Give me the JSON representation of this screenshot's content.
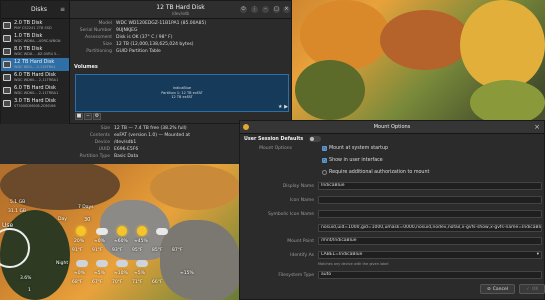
{
  "disks_window": {
    "sidebar_title": "Disks",
    "disks": [
      {
        "name": "2.0 TB Disk",
        "model": "PNY CS2241 2TB SSD"
      },
      {
        "name": "1.0 TB Disk",
        "model": "WDC WD6A...-00RC-WBGN"
      },
      {
        "name": "8.0 TB Disk",
        "model": "WDC WD8... -6Z-0VR4 5..."
      },
      {
        "name": "12 TB Hard Disk",
        "model": "WDC WD1... 2-11EFRA1"
      },
      {
        "name": "6.0 TB Hard Disk",
        "model": "WDC WD60... 2-11TRBA1"
      },
      {
        "name": "6.0 TB Hard Disk",
        "model": "WDC WD60... 2-11TRBA1"
      },
      {
        "name": "3.0 TB Hard Disk",
        "model": "ST3000DM008-2DM166"
      }
    ],
    "selected_index": 3,
    "header_title": "12 TB Hard Disk",
    "header_subtitle": "/dev/sdb",
    "drive_info": [
      {
        "key": "Model",
        "value": "WDC WD120EDGZ-11B1PA1 (85.00A85)"
      },
      {
        "key": "Serial Number",
        "value": "9UJNKJEG"
      },
      {
        "key": "Assessment",
        "value": "Disk is OK (37° C / 98° F)"
      },
      {
        "key": "Size",
        "value": "12 TB (12,000,138,625,024 bytes)"
      },
      {
        "key": "Partitioning",
        "value": "GUID Partition Table"
      }
    ],
    "volumes_label": "Volumes",
    "volume_bar_lines": [
      "IndicaBlue",
      "Partition 1: 12 TB exFAT",
      "12 TB exFAT"
    ],
    "partition_info": [
      {
        "key": "Size",
        "value": "12 TB — 7.4 TB free (38.2% full)"
      },
      {
        "key": "Contents",
        "value": "exFAT (version 1.0) — Mounted at"
      },
      {
        "key": "Device",
        "value": "/dev/sdb1"
      },
      {
        "key": "UUID",
        "value": "E696-E5F6"
      },
      {
        "key": "Partition Type",
        "value": "Basic Data"
      }
    ]
  },
  "mount_dialog": {
    "title": "Mount Options",
    "user_session_defaults": "User Session Defaults",
    "mount_options_label": "Mount Options",
    "opt_startup": "Mount at system startup",
    "opt_show_ui": "Show in user interface",
    "opt_require_auth": "Require additional authorization to mount",
    "display_name_label": "Display Name",
    "display_name_value": "IndicaBlue",
    "icon_name_label": "Icon Name",
    "symbolic_icon_label": "Symbolic Icon Name",
    "options_value": "nosuid,uid=1000,gid=1000,umask=0000,nosuid,nodev,nofail,x-gvfs-show,x-gvfs-name=IndicaBlue",
    "mount_point_label": "Mount Point",
    "mount_point_value": "/mnt/IndicaBlue",
    "identify_as_label": "Identify As",
    "identify_as_value": "LABEL=IndicaBlue",
    "identify_hint": "Matches any device with the given label",
    "fs_type_label": "Filesystem Type",
    "fs_type_value": "auto",
    "cancel_label": "Cancel",
    "ok_label": "OK"
  },
  "weather": {
    "left_values": [
      "5.1 GB",
      "31.1 GB"
    ],
    "use_label": "Use",
    "days_label": "7 Days",
    "day_label": "Day",
    "night_label": "Night",
    "day_temp": "30",
    "day_temps": [
      "91°F",
      "91°F",
      "93°F",
      "95°F",
      "85°F",
      "87°F"
    ],
    "day_pcts": [
      "20%",
      "≈0%",
      "≈60%",
      "≈45%"
    ],
    "night_pcts": [
      "≈0%",
      "≈5%",
      "≈10%",
      "≈5%",
      "≈15%"
    ],
    "night_temps": [
      "68°F",
      "67°F",
      "70°F",
      "71°F",
      "66°F"
    ],
    "bottom_values": [
      "3.6%",
      "1"
    ]
  }
}
